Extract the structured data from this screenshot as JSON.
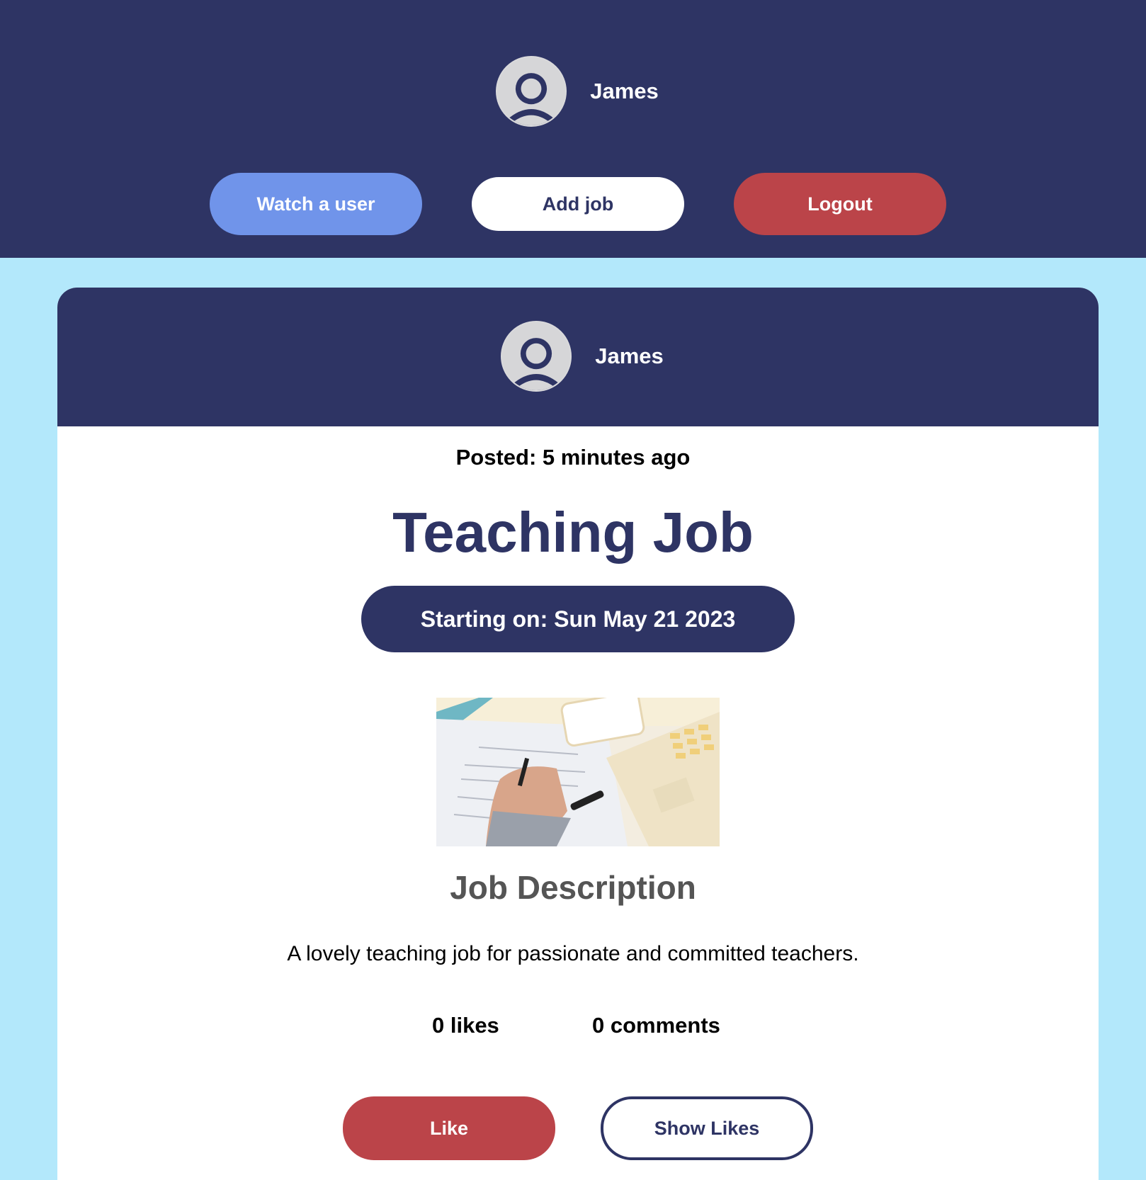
{
  "header": {
    "username": "James",
    "buttons": {
      "watch_user": "Watch a user",
      "add_job": "Add job",
      "logout": "Logout"
    }
  },
  "post": {
    "author": "James",
    "posted": "Posted: 5 minutes ago",
    "title": "Teaching Job",
    "starting_on": "Starting on: Sun May 21 2023",
    "section_title": "Job Description",
    "description": "A lovely teaching job for passionate and committed teachers.",
    "likes": "0 likes",
    "comments": "0 comments",
    "like_button": "Like",
    "show_likes_button": "Show Likes"
  },
  "colors": {
    "navy": "#2e3464",
    "page_bg": "#b3e8fb",
    "watch_blue": "#7094ea",
    "red": "#bb4449"
  },
  "icons": {
    "avatar": "user-avatar-icon"
  }
}
